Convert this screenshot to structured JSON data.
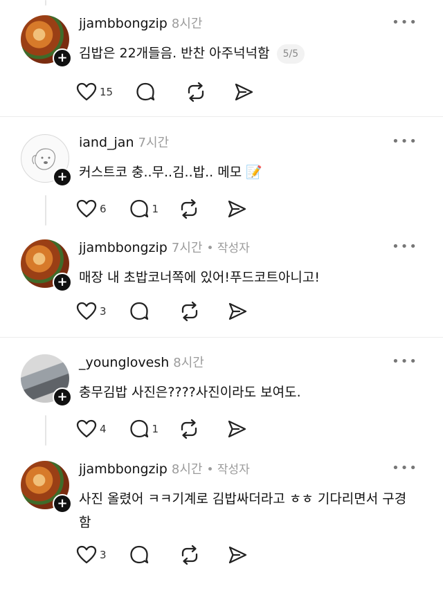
{
  "posts": [
    {
      "username": "jjambbongzip",
      "time": "8시간",
      "author_tag": "",
      "text": "김밥은 22개들음. 반찬 아주넉넉함",
      "thread_count": "5/5",
      "likes": "15",
      "replies": ""
    },
    {
      "username": "iand_jan",
      "time": "7시간",
      "author_tag": "",
      "text": "커스트코 충..무..김..밥.. 메모 📝",
      "likes": "6",
      "replies": "1"
    },
    {
      "username": "jjambbongzip",
      "time": "7시간",
      "author_tag": "• 작성자",
      "text": "매장 내 초밥코너쪽에 있어!푸드코트아니고!",
      "likes": "3",
      "replies": ""
    },
    {
      "username": "_younglovesh",
      "time": "8시간",
      "author_tag": "",
      "text": "충무김밥 사진은????사진이라도 보여도.",
      "likes": "4",
      "replies": "1"
    },
    {
      "username": "jjambbongzip",
      "time": "8시간",
      "author_tag": "• 작성자",
      "text": "사진 올렸어 ㅋㅋ기계로 김밥싸더라고 ㅎㅎ 기다리면서 구경함",
      "likes": "3",
      "replies": ""
    }
  ],
  "more_label": "•••",
  "follow_badge": "+",
  "icons": {
    "like": "heart-icon",
    "reply": "comment-icon",
    "repost": "repost-icon",
    "share": "send-icon"
  }
}
